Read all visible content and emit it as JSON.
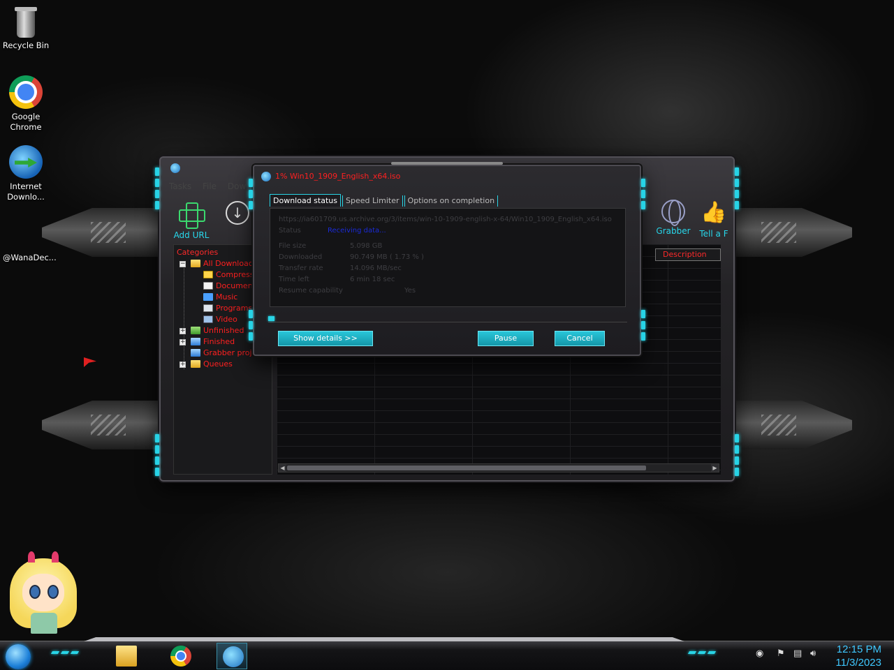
{
  "desktop": {
    "icons": [
      {
        "label": "Recycle Bin"
      },
      {
        "label": "Google Chrome"
      },
      {
        "label": "Internet Downlo..."
      }
    ],
    "user_label": "@WanaDec..."
  },
  "main_window": {
    "menu": [
      "Tasks",
      "File",
      "Dow"
    ],
    "toolbar": {
      "add_url": "Add URL",
      "grabber": "Grabber",
      "tell_friend": "Tell a F"
    },
    "categories": {
      "header": "Categories",
      "items": [
        {
          "label": "All Downloads",
          "expander": "−",
          "icon": "folder-open-icon"
        },
        {
          "label": "Compressed",
          "icon": "zip-icon"
        },
        {
          "label": "Documents",
          "icon": "document-icon"
        },
        {
          "label": "Music",
          "icon": "music-icon"
        },
        {
          "label": "Programs",
          "icon": "program-icon"
        },
        {
          "label": "Video",
          "icon": "video-icon"
        },
        {
          "label": "Unfinished",
          "expander": "+",
          "icon": "unfinished-folder-icon"
        },
        {
          "label": "Finished",
          "expander": "+",
          "icon": "finished-folder-icon"
        },
        {
          "label": "Grabber projects",
          "icon": "grabber-folder-icon"
        },
        {
          "label": "Queues",
          "expander": "+",
          "icon": "queues-folder-icon"
        }
      ]
    },
    "column_header": "Description"
  },
  "download_dialog": {
    "title": "1% Win10_1909_English_x64.iso",
    "tabs": [
      "Download status",
      "Speed Limiter",
      "Options on completion"
    ],
    "url": "https://ia601709.us.archive.org/3/items/win-10-1909-english-x-64/Win10_1909_English_x64.iso",
    "status_label": "Status",
    "status_value": "Receiving data...",
    "rows": [
      {
        "label": "File size",
        "value": "5.098 GB"
      },
      {
        "label": "Downloaded",
        "value": "90.749 MB ( 1.73 % )"
      },
      {
        "label": "Transfer rate",
        "value": "14.096 MB/sec"
      },
      {
        "label": "Time left",
        "value": "6 min 18 sec"
      },
      {
        "label": "Resume capability",
        "value": "Yes"
      }
    ],
    "progress_percent": 1.73,
    "buttons": {
      "show_details": "Show details >>",
      "pause": "Pause",
      "cancel": "Cancel"
    }
  },
  "taskbar": {
    "clock_time": "12:15 PM",
    "clock_date": "11/3/2023"
  },
  "colors": {
    "accent_cyan": "#29d4e6",
    "category_red": "#ff2020",
    "clock_blue": "#3fc8ff"
  }
}
